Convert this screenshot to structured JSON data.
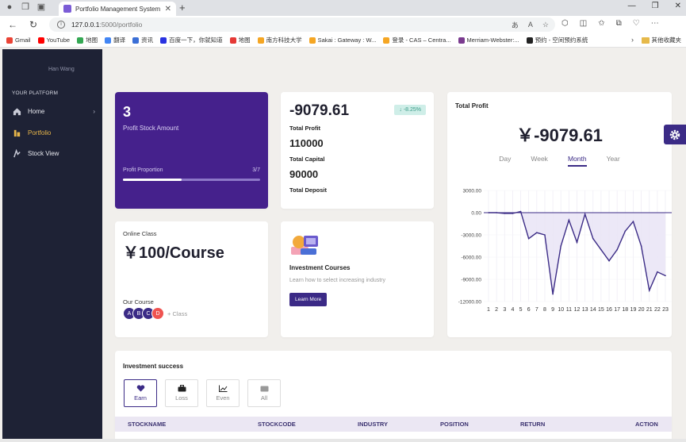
{
  "browser": {
    "tab_title": "Portfolio Management System",
    "url_host": "127.0.0.1",
    "url_path": ":5000/portfolio",
    "bookmarks": [
      {
        "label": "Gmail",
        "color": "#ea4335"
      },
      {
        "label": "YouTube",
        "color": "#ff0000"
      },
      {
        "label": "地图",
        "color": "#34a853"
      },
      {
        "label": "翻译",
        "color": "#4285f4"
      },
      {
        "label": "资讯",
        "color": "#3b6fd6"
      },
      {
        "label": "百度一下，你就知道",
        "color": "#2932e1"
      },
      {
        "label": "地图",
        "color": "#e53935"
      },
      {
        "label": "南方科技大学",
        "color": "#f5a623"
      },
      {
        "label": "Sakai : Gateway : W...",
        "color": "#f5a623"
      },
      {
        "label": "登录 - CAS – Centra...",
        "color": "#f5a623"
      },
      {
        "label": "Merriam-Webster:...",
        "color": "#7a3b8f"
      },
      {
        "label": "预约 - 空间预约系统",
        "color": "#222222"
      }
    ],
    "bookmarks_folder": "其他收藏夹"
  },
  "sidebar": {
    "user_name": "Han Wang",
    "section_label": "YOUR PLATFORM",
    "items": [
      {
        "label": "Home",
        "icon": "home-icon"
      },
      {
        "label": "Portfolio",
        "icon": "folder-icon"
      },
      {
        "label": "Stock View",
        "icon": "chart-icon"
      }
    ]
  },
  "stock_card": {
    "count": "3",
    "label": "Profit Stock Amount",
    "proportion_label": "Profit Proportion",
    "proportion_value": "3/7",
    "proportion_fraction": 0.4286
  },
  "totals_card": {
    "total_profit_value": "-9079.61",
    "change_badge": "-8.25%",
    "total_profit_label": "Total Profit",
    "total_capital_value": "110000",
    "total_capital_label": "Total Capital",
    "total_deposit_value": "90000",
    "total_deposit_label": "Total Deposit"
  },
  "profit_chart": {
    "title": "Total Profit",
    "big_value": "￥-9079.61",
    "periods": [
      "Day",
      "Week",
      "Month",
      "Year"
    ],
    "active_period": "Month"
  },
  "online_class": {
    "title": "Online Class",
    "price": "￥100/Course",
    "our_course": "Our Course",
    "avatars": [
      "A",
      "B",
      "C",
      "D"
    ],
    "avatar_colors": [
      "#3b2b86",
      "#3b2b86",
      "#3b2b86",
      "#ef5350"
    ],
    "more_text": "+ Class"
  },
  "investment_courses": {
    "title": "Investment Courses",
    "description": "Learn how to select increasing industry",
    "button_label": "Learn More"
  },
  "investment_success": {
    "title": "Investment success",
    "filters": [
      "Earn",
      "Loss",
      "Even",
      "All"
    ],
    "active_filter": "Earn",
    "columns": [
      "STOCKNAME",
      "STOCKCODE",
      "INDUSTRY",
      "POSITION",
      "RETURN",
      "ACTION"
    ]
  },
  "chart_data": {
    "type": "area",
    "title": "",
    "x": [
      1,
      2,
      3,
      4,
      5,
      6,
      7,
      8,
      9,
      10,
      11,
      12,
      13,
      14,
      15,
      16,
      17,
      18,
      19,
      20,
      21,
      22,
      23
    ],
    "series": [
      {
        "values": [
          0,
          0,
          -100,
          -100,
          150,
          -3500,
          -2700,
          -3000,
          -11000,
          -4500,
          -1000,
          -4000,
          -200,
          -3500,
          -5000,
          -6500,
          -5000,
          -2500,
          -1200,
          -4500,
          -10500,
          -8000,
          -8500
        ]
      }
    ],
    "ylim": [
      -12000,
      3000
    ],
    "yticks": [
      3000,
      0,
      -3000,
      -6000,
      -9000,
      -12000
    ],
    "ytick_labels": [
      "3000.00",
      "0.00",
      "-3000.00",
      "-6000.00",
      "-9000.00",
      "-12000.00"
    ],
    "xtick_labels": [
      "1",
      "2",
      "3",
      "4",
      "5",
      "6",
      "7",
      "8",
      "9",
      "10",
      "11",
      "12",
      "13",
      "14",
      "15",
      "16",
      "17",
      "18",
      "19",
      "20",
      "21",
      "22",
      "23"
    ],
    "line_color": "#3b2b86",
    "fill_color": "#e9e4f6",
    "grid": true
  },
  "colors": {
    "sidebar_bg": "#1e2235",
    "accent_purple": "#45218c",
    "active_nav": "#e6b54a"
  }
}
